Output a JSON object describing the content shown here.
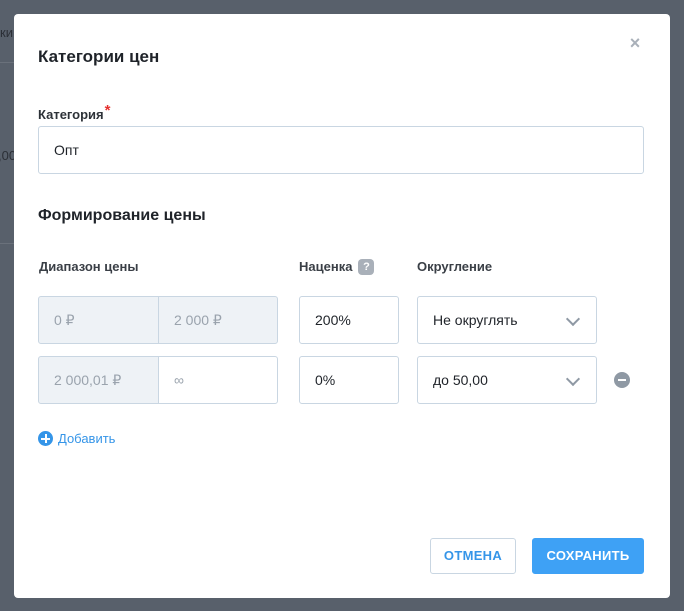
{
  "background": {
    "fragment_top": "ки",
    "fragment_mid": ",00"
  },
  "modal": {
    "title": "Категории цен",
    "close_icon": "×",
    "category": {
      "label": "Категория",
      "required_mark": "*",
      "value": "Опт"
    },
    "pricing": {
      "section_title": "Формирование цены",
      "col_range": "Диапазон цены",
      "col_markup": "Наценка",
      "help_icon": "?",
      "col_rounding": "Округление",
      "rows": [
        {
          "from": "0 ₽",
          "to": "2 000 ₽",
          "markup": "200%",
          "rounding": "Не округлять"
        },
        {
          "from": "2 000,01 ₽",
          "to": "∞",
          "markup": "0%",
          "rounding": "до 50,00"
        }
      ],
      "add_label": "Добавить"
    },
    "buttons": {
      "cancel": "ОТМЕНА",
      "save": "СОХРАНИТЬ"
    }
  },
  "colors": {
    "overlay": "#58606b",
    "accent": "#3595e8",
    "primary_button": "#3ea1f5",
    "required": "#e5312f"
  }
}
